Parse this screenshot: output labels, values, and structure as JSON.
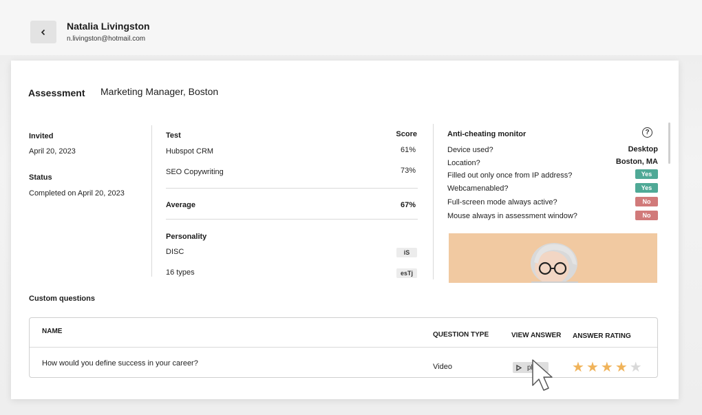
{
  "header": {
    "back_icon": "chevron-left-icon",
    "name": "Natalia Livingston",
    "email": "n.livingston@hotmail.com"
  },
  "assessment": {
    "label": "Assessment",
    "value": "Marketing Manager, Boston"
  },
  "candidate_info": {
    "invited_label": "Invited",
    "invited_value": "April 20, 2023",
    "status_label": "Status",
    "status_value": "Completed on April 20, 2023"
  },
  "tests": {
    "col_test": "Test",
    "col_score": "Score",
    "rows": [
      {
        "name": "Hubspot CRM",
        "score": "61%"
      },
      {
        "name": "SEO Copywriting",
        "score": "73%"
      }
    ],
    "average_label": "Average",
    "average_value": "67%",
    "personality_label": "Personality",
    "personality": [
      {
        "name": "DISC",
        "value": "iS"
      },
      {
        "name": "16 types",
        "value": "esTj"
      }
    ]
  },
  "anti_cheating": {
    "title": "Anti-cheating monitor",
    "help_icon": "question-circle-icon",
    "help_glyph": "?",
    "device_label": "Device used?",
    "device_value": "Desktop",
    "location_label": "Location?",
    "location_value": "Boston, MA",
    "checks": [
      {
        "label": "Filled out only once from IP address?",
        "value": "Yes"
      },
      {
        "label": "Webcamenabled?",
        "value": "Yes"
      },
      {
        "label": "Full-screen mode always active?",
        "value": "No"
      },
      {
        "label": "Mouse always in assessment window?",
        "value": "No"
      }
    ],
    "colors": {
      "yes": "#4fa996",
      "no": "#d17a7a"
    }
  },
  "custom_questions": {
    "title": "Custom questions",
    "headers": {
      "name": "NAME",
      "type": "QUESTION TYPE",
      "view": "VIEW ANSWER",
      "rating": "ANSWER RATING"
    },
    "row": {
      "question": "How would you define success in your career?",
      "type": "Video",
      "play_label": "play",
      "play_icon": "play-icon",
      "rating": 4,
      "rating_max": 5
    },
    "star_colors": {
      "filled": "#f0b35a",
      "empty": "#d9d9d9"
    }
  }
}
